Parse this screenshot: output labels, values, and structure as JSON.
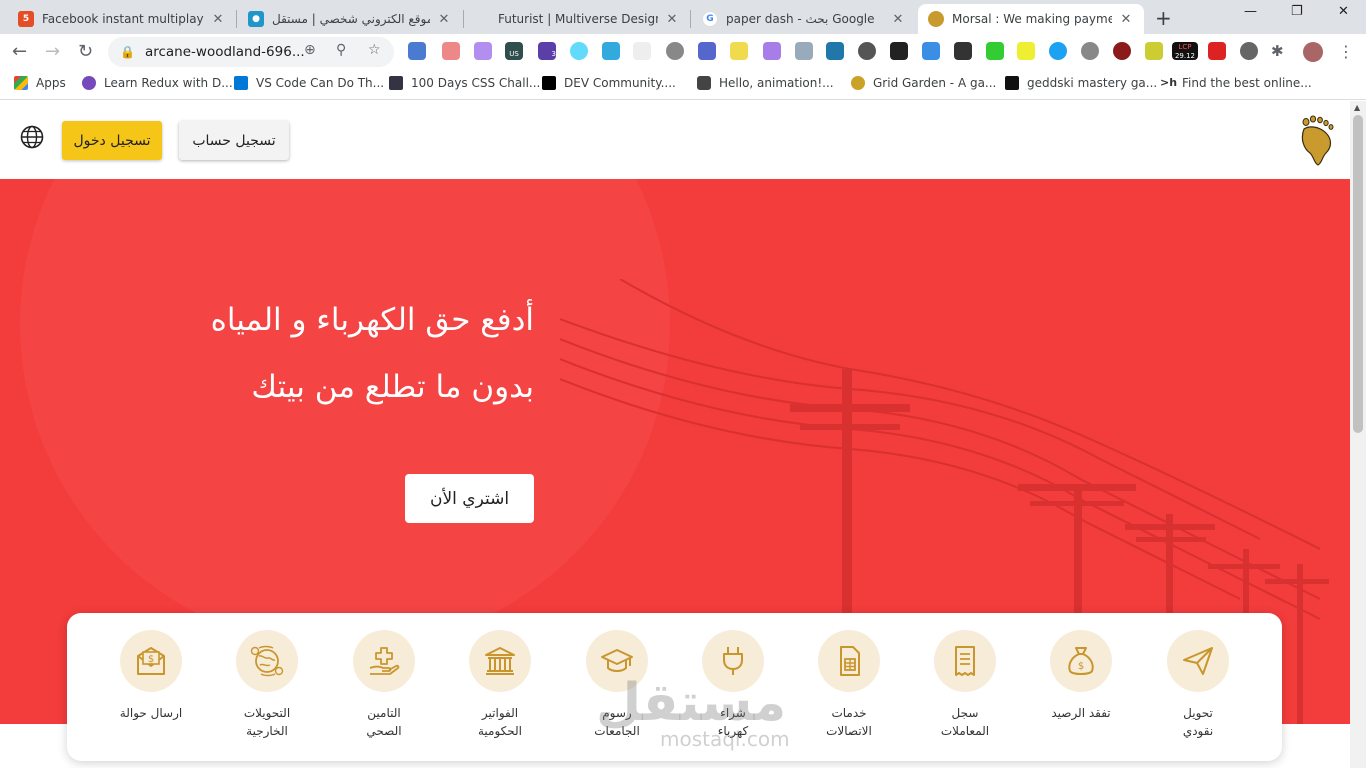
{
  "browser": {
    "tabs": [
      {
        "title": "Facebook instant multiplayer g",
        "active": false
      },
      {
        "title": "موقع الكتروني شخصي | مستقل",
        "active": false
      },
      {
        "title": "Futurist | Multiverse Design",
        "active": false
      },
      {
        "title": "paper dash - بحث Google",
        "active": false
      },
      {
        "title": "Morsal : We making payment e",
        "active": true
      }
    ],
    "new_tab": "+",
    "address": "arcane-woodland-696...",
    "bookmarks": [
      {
        "label": "Apps"
      },
      {
        "label": "Learn Redux with D..."
      },
      {
        "label": "VS Code Can Do Th..."
      },
      {
        "label": "100 Days CSS Chall..."
      },
      {
        "label": "DEV Community...."
      },
      {
        "label": "Hello, animation!..."
      },
      {
        "label": "Grid Garden - A ga..."
      },
      {
        "label": "geddski mastery ga..."
      },
      {
        "label": "Find the best online..."
      }
    ],
    "ext_badges": {
      "us": "US",
      "three": "3",
      "lcp": "LCP",
      "lcp_val": "29.12"
    }
  },
  "header": {
    "login_label": "تسجيل دخول",
    "signup_label": "تسجيل حساب"
  },
  "hero": {
    "line1": "أدفع حق الكهرباء و المياه",
    "line2": "بدون ما تطلع من بيتك",
    "buy_label": "اشتري الأن"
  },
  "services": [
    {
      "label": "تحويل\nنقودي",
      "icon": "paper-plane-icon"
    },
    {
      "label": "تفقد الرصيد",
      "icon": "money-bag-icon"
    },
    {
      "label": "سجل\nالمعاملات",
      "icon": "receipt-icon"
    },
    {
      "label": "خدمات\nالاتصالات",
      "icon": "sim-card-icon"
    },
    {
      "label": "شراء\nكهرباء",
      "icon": "plug-icon"
    },
    {
      "label": "رسوم\nالجامعات",
      "icon": "graduation-cap-icon"
    },
    {
      "label": "الفواتير\nالحكومية",
      "icon": "government-building-icon"
    },
    {
      "label": "التامين\nالصحي",
      "icon": "health-hand-icon"
    },
    {
      "label": "التحويلات\nالخارجية",
      "icon": "globe-transfer-icon"
    },
    {
      "label": "ارسال حوالة",
      "icon": "money-envelope-icon"
    }
  ],
  "watermark": {
    "ar": "مستقل",
    "en": "mostaql.com"
  },
  "colors": {
    "hero": "#f33c3c",
    "accent": "#f5c518",
    "icon_bg": "#f7ecd8",
    "icon_stroke": "#c9962e"
  }
}
